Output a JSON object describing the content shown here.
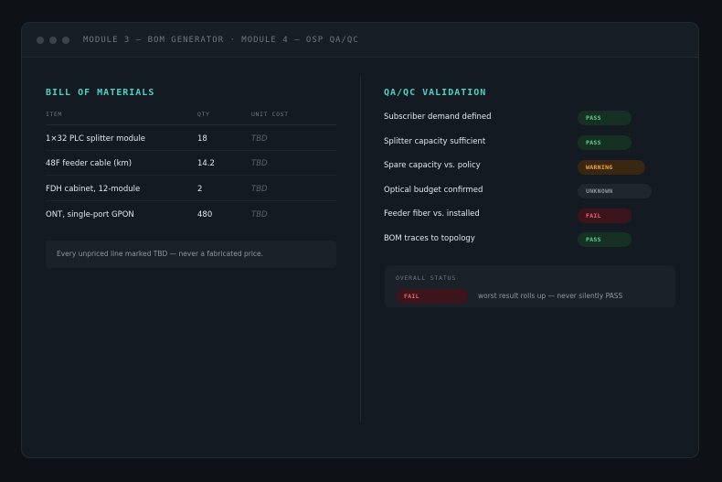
{
  "window": {
    "title": "MODULE 3 — BOM GENERATOR · MODULE 4 — OSP QA/QC"
  },
  "bom": {
    "heading": "BILL OF MATERIALS",
    "columns": [
      "ITEM",
      "QTY",
      "UNIT COST"
    ],
    "rows": [
      {
        "item": "1×32 PLC splitter module",
        "qty": "18",
        "unit_cost": "TBD"
      },
      {
        "item": "48F feeder cable (km)",
        "qty": "14.2",
        "unit_cost": "TBD"
      },
      {
        "item": "FDH cabinet, 12-module",
        "qty": "2",
        "unit_cost": "TBD"
      },
      {
        "item": "ONT, single-port GPON",
        "qty": "480",
        "unit_cost": "TBD"
      }
    ],
    "note": "Every unpriced line marked TBD — never a fabricated price."
  },
  "qa": {
    "heading": "QA/QC VALIDATION",
    "checks": [
      {
        "label": "Subscriber demand defined",
        "status": "PASS"
      },
      {
        "label": "Splitter capacity sufficient",
        "status": "PASS"
      },
      {
        "label": "Spare capacity vs. policy",
        "status": "WARNING"
      },
      {
        "label": "Optical budget confirmed",
        "status": "UNKNOWN"
      },
      {
        "label": "Feeder fiber vs. installed",
        "status": "FAIL"
      },
      {
        "label": "BOM traces to topology",
        "status": "PASS"
      }
    ],
    "overall": {
      "label": "OVERALL STATUS",
      "status": "FAIL",
      "text": "worst result rolls up — never silently PASS"
    }
  },
  "colors": {
    "accent": "#4fd1c5",
    "pass": "#5fd38d",
    "warning": "#f0a53c",
    "unknown": "#8c96a1",
    "fail": "#f06273"
  }
}
